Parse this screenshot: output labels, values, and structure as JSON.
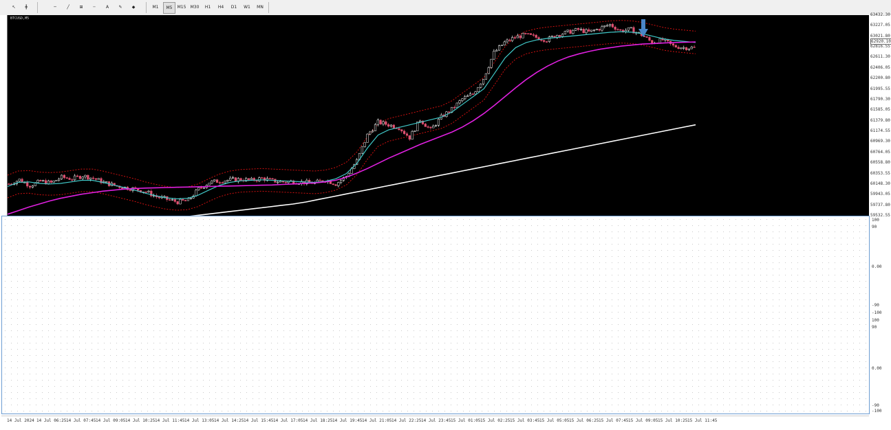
{
  "toolbar": {
    "tools": [
      "↖",
      "╋",
      "─",
      "╱",
      "⊞",
      "╌",
      "A",
      "✎",
      "◆"
    ],
    "timeframes": [
      "M1",
      "M5",
      "M15",
      "M30",
      "H1",
      "H4",
      "D1",
      "W1",
      "MN"
    ],
    "active_timeframe": "M5"
  },
  "chart_data": {
    "type": "candlestick",
    "symbol_label": "BTCUSD,M5",
    "indicators": [
      "Bollinger Bands (dashed red)",
      "MA fast (cyan)",
      "MA medium (magenta)",
      "MA slow (white)"
    ],
    "price_axis": [
      "63432.30",
      "63227.05",
      "63021.80",
      "62816.55",
      "62611.30",
      "62406.05",
      "62200.80",
      "61995.55",
      "61790.30",
      "61585.05",
      "61379.80",
      "61174.55",
      "60969.30",
      "60764.05",
      "60558.80",
      "60353.55",
      "60148.30",
      "59943.05",
      "59737.80",
      "59532.55"
    ],
    "current_price": "62920.10",
    "ylim": [
      59532.55,
      63432.3
    ],
    "time_axis": [
      "14 Jul 2024",
      "14 Jul 06:25",
      "14 Jul 07:45",
      "14 Jul 09:05",
      "14 Jul 10:25",
      "14 Jul 11:45",
      "14 Jul 13:05",
      "14 Jul 14:25",
      "14 Jul 15:45",
      "14 Jul 17:05",
      "14 Jul 18:25",
      "14 Jul 19:45",
      "14 Jul 21:05",
      "14 Jul 22:25",
      "14 Jul 23:45",
      "15 Jul 01:05",
      "15 Jul 02:25",
      "15 Jul 03:45",
      "15 Jul 05:05",
      "15 Jul 06:25",
      "15 Jul 07:45",
      "15 Jul 09:05",
      "15 Jul 10:25",
      "15 Jul 11:45"
    ],
    "close_series": [
      60150,
      60230,
      60120,
      60200,
      60170,
      60280,
      60250,
      60310,
      60260,
      60180,
      60120,
      60080,
      60050,
      60000,
      59900,
      59850,
      59800,
      59830,
      60050,
      60180,
      60210,
      60230,
      60240,
      60220,
      60260,
      60210,
      60190,
      60200,
      60180,
      60170,
      60230,
      60150,
      60300,
      60600,
      61100,
      61350,
      61300,
      61250,
      61050,
      61400,
      61200,
      61450,
      61600,
      61800,
      61900,
      62200,
      62700,
      62900,
      63000,
      63050,
      63000,
      62950,
      63050,
      63100,
      63150,
      63100,
      63170,
      63250,
      63130,
      63150,
      63050,
      62900,
      62950,
      62830,
      62800,
      62800
    ],
    "ma_fast": [
      60100,
      60180,
      60190,
      60160,
      60150,
      60160,
      60190,
      60220,
      60220,
      60180,
      60130,
      60080,
      60030,
      59970,
      59920,
      59880,
      59860,
      59870,
      59930,
      60030,
      60120,
      60180,
      60210,
      60220,
      60230,
      60220,
      60210,
      60200,
      60190,
      60180,
      60200,
      60250,
      60350,
      60550,
      60850,
      61100,
      61200,
      61250,
      61300,
      61350,
      61400,
      61450,
      61550,
      61700,
      61850,
      62000,
      62300,
      62600,
      62800,
      62900,
      62950,
      62980,
      63000,
      63020,
      63040,
      63060,
      63080,
      63100,
      63110,
      63100,
      63070,
      63020,
      62970,
      62940,
      62920,
      62900
    ],
    "ma_medium": [
      59560,
      59630,
      59700,
      59760,
      59820,
      59870,
      59910,
      59950,
      59980,
      60010,
      60030,
      60050,
      60060,
      60070,
      60075,
      60080,
      60085,
      60090,
      60095,
      60100,
      60105,
      60110,
      60115,
      60120,
      60125,
      60130,
      60140,
      60150,
      60160,
      60170,
      60190,
      60220,
      60280,
      60360,
      60450,
      60550,
      60650,
      60740,
      60830,
      60920,
      61000,
      61080,
      61160,
      61260,
      61380,
      61520,
      61680,
      61850,
      62020,
      62180,
      62320,
      62440,
      62540,
      62620,
      62680,
      62730,
      62770,
      62800,
      62830,
      62850,
      62870,
      62880,
      62890,
      62900,
      62905,
      62910
    ],
    "ma_slow": [
      59100,
      59130,
      59160,
      59190,
      59220,
      59250,
      59280,
      59310,
      59340,
      59370,
      59400,
      59430,
      59460,
      59490,
      59520,
      59550,
      59580,
      59610,
      59640,
      59670,
      59700,
      59730,
      59760,
      59800,
      59850,
      59900,
      59950,
      60000,
      60050,
      60100,
      60150,
      60200,
      60250,
      60300,
      60350,
      60400,
      60450,
      60500,
      60550,
      60600,
      60650,
      60700,
      60750,
      60800,
      60850,
      60900,
      60950,
      61000,
      61050,
      61100,
      61150,
      61200,
      61250,
      61300
    ],
    "bb_width": 220
  },
  "sub_indicator": {
    "labels": [
      "100",
      "90",
      "0.00",
      "-90",
      "-100",
      "100",
      "90",
      "0.00",
      "-90",
      "-100"
    ]
  }
}
